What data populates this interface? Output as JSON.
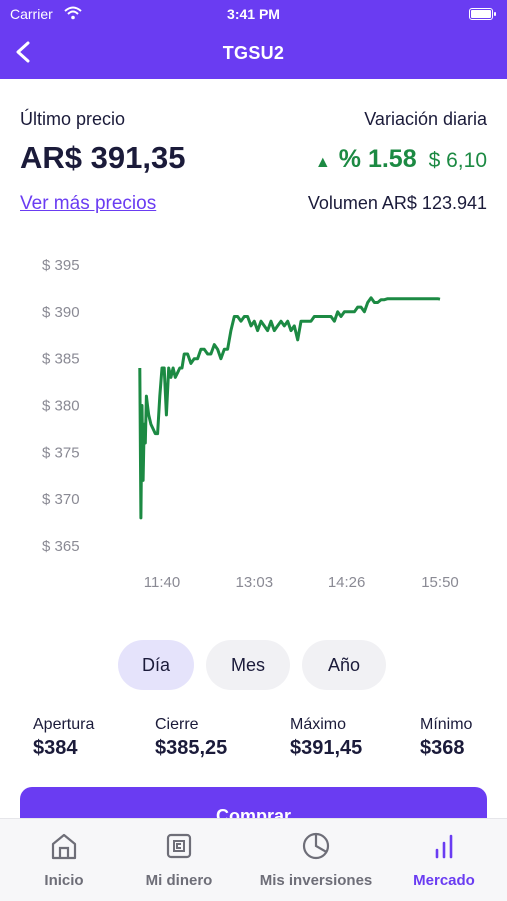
{
  "status_bar": {
    "carrier": "Carrier",
    "time": "3:41 PM"
  },
  "nav": {
    "title": "TGSU2",
    "back_icon": "chevron-left-icon"
  },
  "quote": {
    "last_price_label": "Último precio",
    "last_price": "AR$ 391,35",
    "more_prices_link": "Ver más precios",
    "daily_variation_label": "Variación diaria",
    "variation_percent": "% 1.58",
    "variation_amount": "$ 6,10",
    "volume": "Volumen AR$ 123.941",
    "variation_color": "#1c8a43"
  },
  "chart_data": {
    "type": "line",
    "title": "",
    "xlabel": "",
    "ylabel": "",
    "y_tick_labels": [
      "$ 395",
      "$ 390",
      "$ 385",
      "$ 380",
      "$ 375",
      "$ 370",
      "$ 365"
    ],
    "y_ticks": [
      395,
      390,
      385,
      380,
      375,
      370,
      365
    ],
    "ylim": [
      365,
      395
    ],
    "x_tick_labels": [
      "11:40",
      "13:03",
      "14:26",
      "15:50"
    ],
    "x_ticks": [
      "11:40",
      "13:03",
      "14:26",
      "15:50"
    ],
    "grid": false,
    "color": "#1c8a43",
    "series": [
      {
        "x": [
          "11:20",
          "11:21",
          "11:22",
          "11:23",
          "11:24",
          "11:25",
          "11:26",
          "11:27",
          "11:28",
          "11:30",
          "11:32",
          "11:34",
          "11:36",
          "11:38",
          "11:40",
          "11:42",
          "11:44",
          "11:46",
          "11:48",
          "11:50",
          "11:52",
          "11:54",
          "11:56",
          "11:58",
          "12:00",
          "12:03",
          "12:06",
          "12:09",
          "12:12",
          "12:15",
          "12:18",
          "12:21",
          "12:24",
          "12:27",
          "12:30",
          "12:33",
          "12:36",
          "12:39",
          "12:42",
          "12:45",
          "12:48",
          "12:51",
          "12:54",
          "12:57",
          "13:00",
          "13:03",
          "13:06",
          "13:09",
          "13:12",
          "13:15",
          "13:18",
          "13:21",
          "13:24",
          "13:27",
          "13:30",
          "13:33",
          "13:36",
          "13:39",
          "13:42",
          "13:45",
          "13:48",
          "13:51",
          "13:54",
          "13:57",
          "14:00",
          "14:03",
          "14:06",
          "14:09",
          "14:12",
          "14:15",
          "14:18",
          "14:21",
          "14:24",
          "14:27",
          "14:30",
          "14:33",
          "14:36",
          "14:39",
          "14:42",
          "14:45",
          "14:48",
          "14:51",
          "14:54",
          "14:57",
          "15:00",
          "15:03",
          "15:06",
          "15:09",
          "15:12",
          "15:15",
          "15:18",
          "15:21",
          "15:24",
          "15:27",
          "15:30",
          "15:33",
          "15:36",
          "15:39",
          "15:42",
          "15:45",
          "15:48",
          "15:50"
        ],
        "y": [
          384,
          368,
          380,
          372,
          378,
          376,
          381,
          380,
          379,
          378,
          377.5,
          377,
          377,
          381,
          384,
          384,
          379,
          384,
          383,
          384,
          383,
          383.5,
          384,
          384,
          385.5,
          385.5,
          384.5,
          385,
          385,
          386,
          386,
          385.5,
          385.5,
          386.5,
          386,
          385,
          386,
          386,
          388,
          389.5,
          389.5,
          389,
          389.5,
          389.5,
          388.5,
          389,
          388,
          389,
          388.5,
          388,
          389,
          388,
          388.5,
          389,
          388.5,
          389,
          388,
          388.5,
          387,
          389,
          389,
          389,
          389,
          389.5,
          389.5,
          389.5,
          389.5,
          389.5,
          389.5,
          389,
          390,
          389.5,
          390,
          390,
          390,
          390,
          390.5,
          390.5,
          390,
          391,
          391.5,
          391,
          391,
          391.3,
          391.3,
          391.4,
          391.4,
          391.4,
          391.4,
          391.4,
          391.4,
          391.4,
          391.4,
          391.4,
          391.4,
          391.4,
          391.4,
          391.4,
          391.4,
          391.4,
          391.4,
          391.35
        ]
      }
    ]
  },
  "periods": {
    "items": [
      "Día",
      "Mes",
      "Año"
    ],
    "selected": "Día"
  },
  "stats": [
    {
      "label": "Apertura",
      "value": "$384"
    },
    {
      "label": "Cierre",
      "value": "$385,25"
    },
    {
      "label": "Máximo",
      "value": "$391,45"
    },
    {
      "label": "Mínimo",
      "value": "$368"
    }
  ],
  "buy_button": {
    "label": "Comprar"
  },
  "tabbar": {
    "items": [
      {
        "label": "Inicio",
        "icon": "home-icon"
      },
      {
        "label": "Mi dinero",
        "icon": "wallet-icon"
      },
      {
        "label": "Mis inversiones",
        "icon": "pie-chart-icon"
      },
      {
        "label": "Mercado",
        "icon": "bar-chart-icon"
      }
    ],
    "active": "Mercado"
  },
  "colors": {
    "brand": "#6a3cf2",
    "positive": "#1c8a43"
  }
}
